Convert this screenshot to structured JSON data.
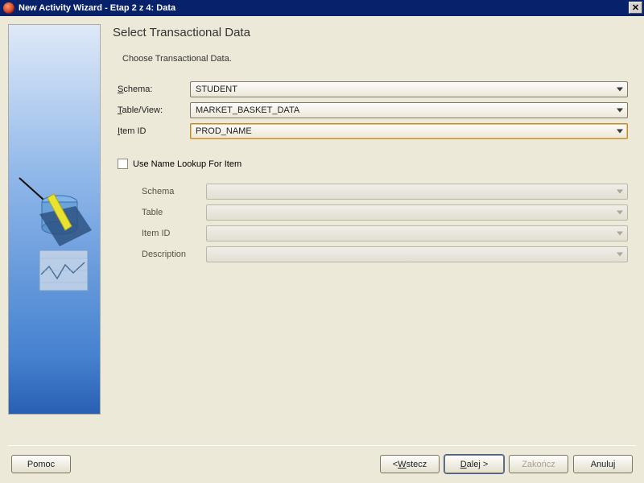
{
  "titlebar": {
    "title": "New Activity Wizard - Etap 2 z 4: Data"
  },
  "heading": "Select Transactional Data",
  "subheading": "Choose Transactional Data.",
  "labels": {
    "schema": "Schema:",
    "schema_u": "S",
    "tableview_pre": "T",
    "tableview": "able/View:",
    "itemid_pre": "I",
    "itemid": "tem ID",
    "useNameLookup": "Use Name Lookup For Item",
    "lk_schema": "Schema",
    "lk_table": "Table",
    "lk_itemid": "Item ID",
    "lk_description": "Description"
  },
  "values": {
    "schema": "STUDENT",
    "tableview": "MARKET_BASKET_DATA",
    "itemid": "PROD_NAME",
    "lk_schema": "",
    "lk_table": "",
    "lk_itemid": "",
    "lk_description": ""
  },
  "buttons": {
    "help": "Pomoc",
    "back_u": "W",
    "back_rest": "stecz",
    "next_u": "D",
    "next_rest": "alej >",
    "finish": "Zakończ",
    "cancel": "Anuluj"
  }
}
